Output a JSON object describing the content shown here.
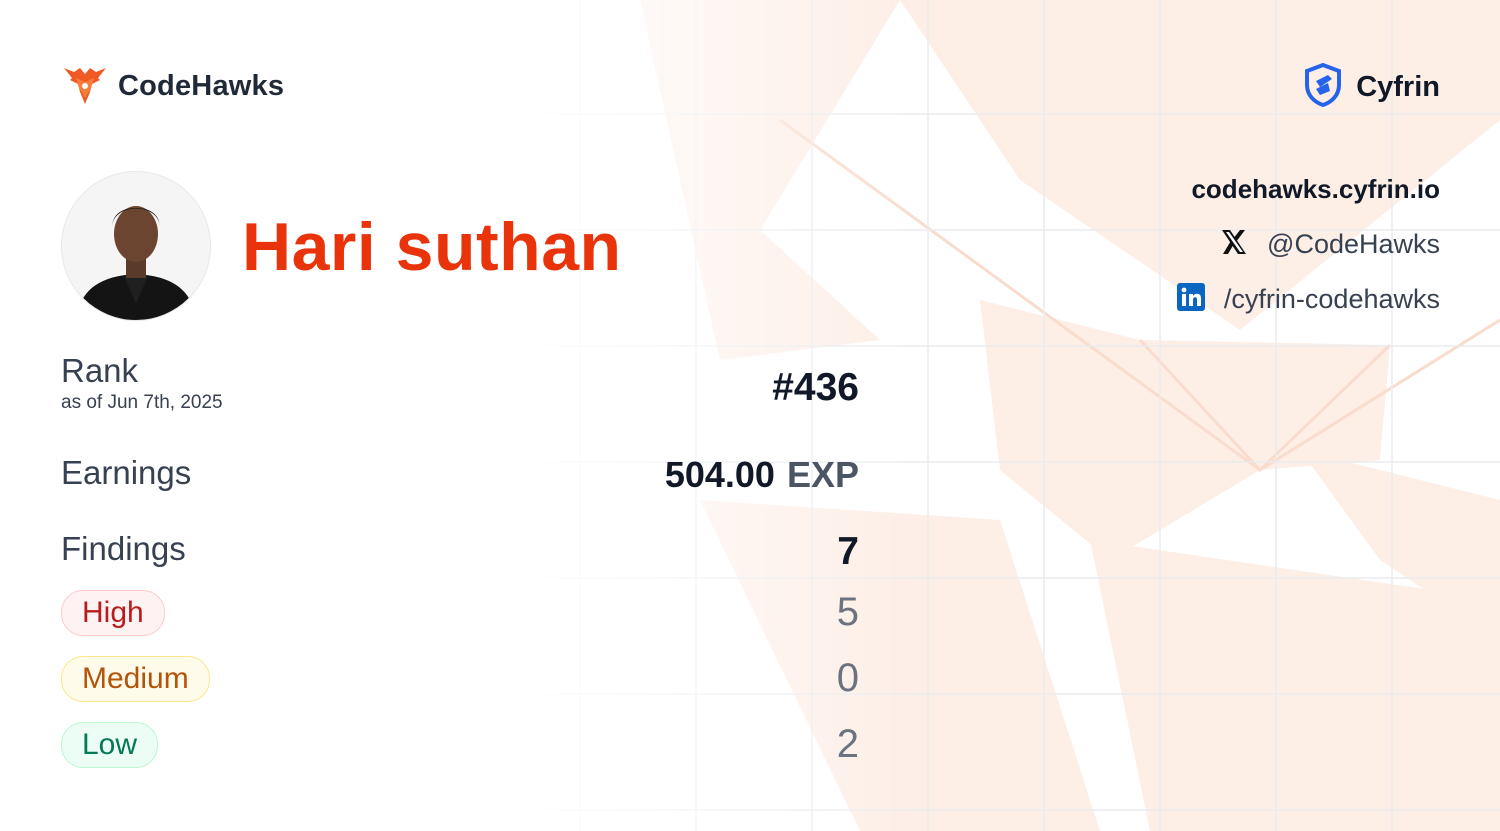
{
  "brand": {
    "name": "CodeHawks",
    "icon": "hawk-logo-icon",
    "color": "#ef5a24"
  },
  "partner": {
    "name": "Cyfrin",
    "icon": "cyfrin-shield-icon",
    "color": "#1d4ed8"
  },
  "profile": {
    "name": "Hari suthan",
    "name_color": "#e8330b",
    "avatar": "avatar-photo"
  },
  "links": {
    "site": "codehawks.cyfrin.io",
    "x": {
      "icon": "x-logo-icon",
      "handle": "@CodeHawks"
    },
    "linkedin": {
      "icon": "linkedin-icon",
      "handle": "/cyfrin-codehawks"
    }
  },
  "stats": {
    "rank": {
      "label": "Rank",
      "date": "as of Jun 7th, 2025",
      "value": "#436"
    },
    "earnings": {
      "label": "Earnings",
      "value": "504.00",
      "unit": "EXP"
    },
    "findings": {
      "label": "Findings",
      "total": "7",
      "severities": [
        {
          "label": "High",
          "count": "5",
          "color": "#b91c1c"
        },
        {
          "label": "Medium",
          "count": "0",
          "color": "#b45309"
        },
        {
          "label": "Low",
          "count": "2",
          "color": "#047857"
        }
      ]
    }
  }
}
